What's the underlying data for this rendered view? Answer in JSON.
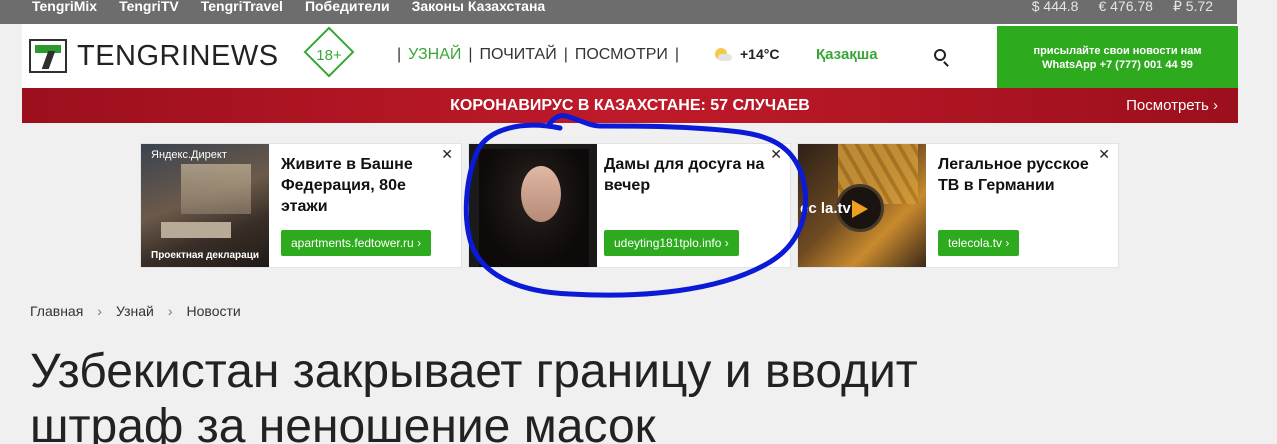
{
  "topbar": {
    "links": [
      "TengriMix",
      "TengriTV",
      "TengriTravel",
      "Победители",
      "Законы Казахстана"
    ],
    "rates": [
      "$ 444.8",
      "€ 476.78",
      "₽ 5.72"
    ]
  },
  "header": {
    "logo_text": "TENGRINEWS",
    "age_badge": "18+",
    "nav": [
      "УЗНАЙ",
      "ПОЧИТАЙ",
      "ПОСМОТРИ"
    ],
    "weather": "+14°C",
    "language": "Қазақша",
    "whatsapp_line1": "присылайте свои новости нам",
    "whatsapp_line2": "WhatsApp +7 (777) 001 44 99"
  },
  "banner": {
    "title": "КОРОНАВИРУС В КАЗАХСТАНЕ: 57 СЛУЧАЕВ",
    "more": "Посмотреть ›"
  },
  "ads": [
    {
      "source": "Яндекс.Директ",
      "caption": "Проектная деклараци",
      "headline": "Живите в Башне Федерация, 80е этажи",
      "button": "apartments.fedtower.ru ›",
      "close": "✕"
    },
    {
      "headline": "Дамы для досуга на вечер",
      "button": "udeyting181tplo.info ›",
      "close": "✕"
    },
    {
      "image_text": "ec   la.tv",
      "headline": "Легальное русское ТВ в Германии",
      "button": "telecola.tv ›",
      "close": "✕"
    }
  ],
  "breadcrumb": [
    "Главная",
    "Узнай",
    "Новости"
  ],
  "article": {
    "title": "Узбекистан закрывает границу и вводит штраф за неношение масок"
  },
  "colors": {
    "brand_green": "#2eaa1e",
    "banner_red": "#b3182a",
    "annotation_blue": "#0a1ad6"
  }
}
